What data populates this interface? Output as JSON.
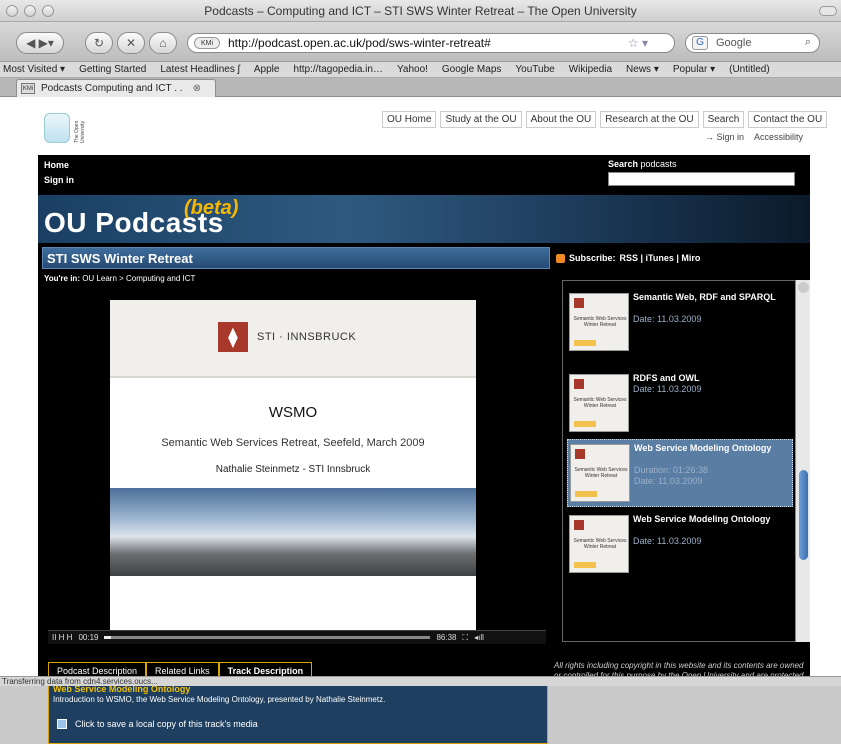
{
  "window": {
    "title": "Podcasts – Computing and ICT – STI SWS Winter Retreat – The Open University"
  },
  "toolbar": {
    "url": "http://podcast.open.ac.uk/pod/sws-winter-retreat#",
    "site_badge": "KMi",
    "search_placeholder": "Google"
  },
  "bookmarks": [
    "Most Visited ▾",
    "Getting Started",
    "Latest Headlines ʃ",
    "Apple",
    "http://tagopedia.in…",
    "Yahoo!",
    "Google Maps",
    "YouTube",
    "Wikipedia",
    "News ▾",
    "Popular ▾",
    "(Untitled)"
  ],
  "tab": {
    "favicon": "KMi",
    "label": "Podcasts   Computing and ICT . ."
  },
  "ou": {
    "logo_text": "The Open University",
    "topnav": [
      "OU Home",
      "Study at the OU",
      "About the OU",
      "Research at the OU",
      "Search",
      "Contact the OU"
    ],
    "subnav": [
      "→ Sign in",
      "Accessibility"
    ]
  },
  "site": {
    "home": "Home",
    "signin": "Sign in",
    "search_label_bold": "Search",
    "search_label_rest": " podcasts",
    "banner_title": "OU Podcasts",
    "banner_beta": "(beta)",
    "content_title": "STI SWS Winter Retreat",
    "youre_in_label": "You're in:",
    "youre_in_path": " OU Learn > Computing and ICT"
  },
  "slide": {
    "sti_logo": "⧫",
    "sti_text": "STI · INNSBRUCK",
    "title": "WSMO",
    "subtitle": "Semantic Web Services Retreat, Seefeld, March 2009",
    "author": "Nathalie Steinmetz - STI Innsbruck"
  },
  "player": {
    "controls": "II  H  H",
    "time_current": "00:19",
    "time_total": "86:38",
    "progress": 0.02
  },
  "tabs": [
    "Podcast Description",
    "Related Links",
    "Track Description"
  ],
  "description": {
    "title": "Web Service Modeling Ontology",
    "text": "Introduction to WSMO, the Web Service Modeling Ontology, presented by Nathalie Steinmetz.",
    "save": "Click to save a local copy of this track's media"
  },
  "subscribe": {
    "label": "Subscribe:",
    "links": "RSS | iTunes | Miro"
  },
  "episodes": [
    {
      "title": "Semantic Web, RDF and SPARQL",
      "line1": "Date: 11.03.2009",
      "line2": "",
      "selected": false
    },
    {
      "title": "RDFS and OWL",
      "line1": "Date: 11.03.2009",
      "line2": "",
      "selected": false
    },
    {
      "title": "Web Service Modeling Ontology",
      "line1": "Duration: 01:26:38",
      "line2": "Date: 11.03.2009",
      "selected": true
    },
    {
      "title": "Web Service Modeling Ontology",
      "line1": "Date: 11.03.2009",
      "line2": "",
      "selected": false
    }
  ],
  "thumb_text": "Semantic Web Services Winter Retreat",
  "rights": "All rights including copyright in this website and its contents are owned or controlled for this purpose by the Open University and are protected by copyright in the United Kingdom and by international treaties worldwide.",
  "status": "Transferring data from cdn4.services.oucs..."
}
